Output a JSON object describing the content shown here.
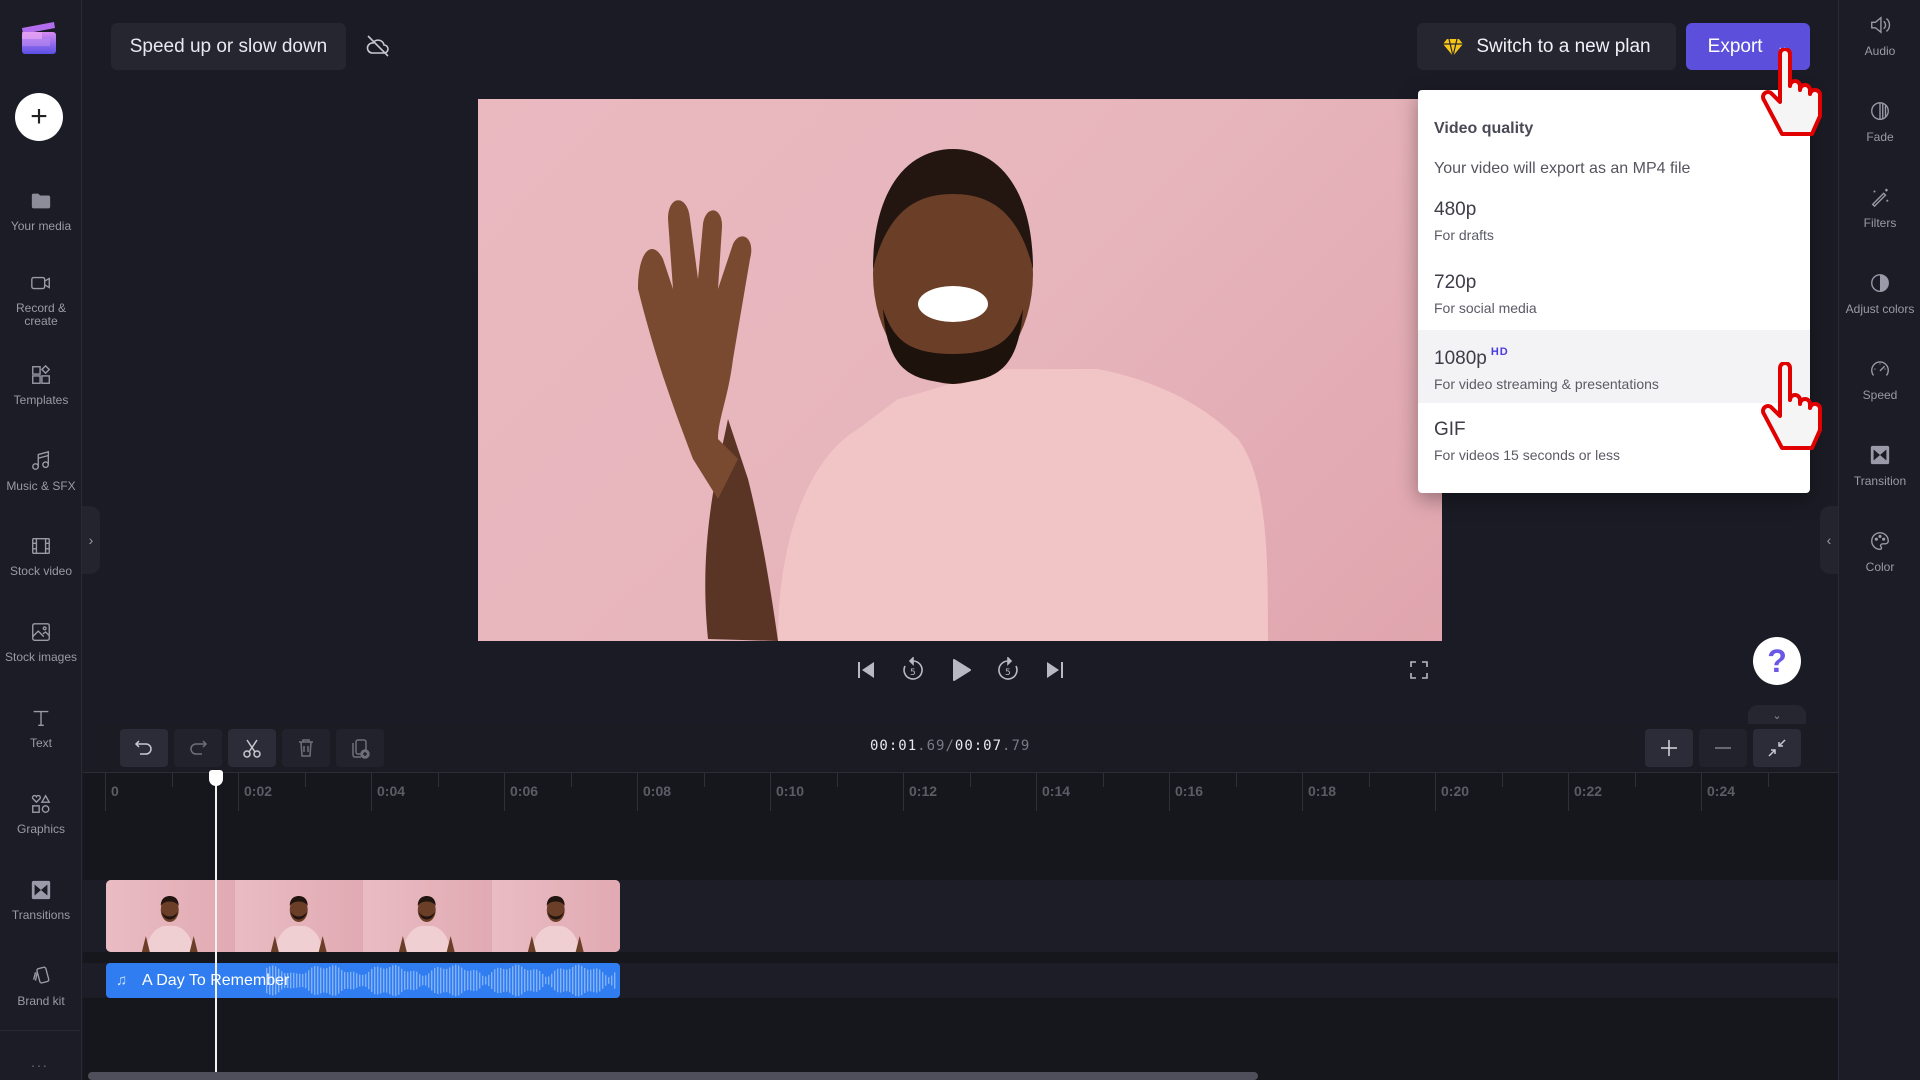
{
  "app": {
    "project_title": "Speed up or slow down",
    "cloud_status_icon": "cloud-off-icon"
  },
  "header": {
    "plan_button": "Switch to a new plan",
    "plan_icon": "diamond-icon",
    "export_button": "Export",
    "export_color": "#5b4fdb"
  },
  "left_sidebar": {
    "add_icon": "plus-icon",
    "items": [
      {
        "label": "Your media",
        "icon": "folder-icon"
      },
      {
        "label": "Record & create",
        "icon": "camera-icon"
      },
      {
        "label": "Templates",
        "icon": "templates-icon"
      },
      {
        "label": "Music & SFX",
        "icon": "music-icon"
      },
      {
        "label": "Stock video",
        "icon": "film-icon"
      },
      {
        "label": "Stock images",
        "icon": "image-icon"
      },
      {
        "label": "Text",
        "icon": "text-icon"
      },
      {
        "label": "Graphics",
        "icon": "shapes-icon"
      },
      {
        "label": "Transitions",
        "icon": "transition-icon"
      },
      {
        "label": "Brand kit",
        "icon": "brand-kit-icon"
      }
    ],
    "more_label": "..."
  },
  "right_sidebar": {
    "items": [
      {
        "label": "Audio",
        "icon": "speaker-icon"
      },
      {
        "label": "Fade",
        "icon": "fade-icon"
      },
      {
        "label": "Filters",
        "icon": "magic-wand-icon"
      },
      {
        "label": "Adjust colors",
        "icon": "contrast-icon"
      },
      {
        "label": "Speed",
        "icon": "speedometer-icon"
      },
      {
        "label": "Transition",
        "icon": "transition-icon"
      },
      {
        "label": "Color",
        "icon": "palette-icon"
      }
    ]
  },
  "export_menu": {
    "title": "Video quality",
    "subtitle": "Your video will export as an MP4 file",
    "options": [
      {
        "name": "480p",
        "desc": "For drafts",
        "badge": ""
      },
      {
        "name": "720p",
        "desc": "For social media",
        "badge": ""
      },
      {
        "name": "1080p",
        "desc": "For video streaming & presentations",
        "badge": "HD",
        "highlighted": true
      },
      {
        "name": "GIF",
        "desc": "For videos 15 seconds or less",
        "badge": ""
      }
    ]
  },
  "player": {
    "controls": [
      "skip-to-start",
      "rewind-5",
      "play",
      "forward-5",
      "skip-to-end",
      "fullscreen"
    ],
    "help_label": "?"
  },
  "timeline": {
    "current_time_main": "00:01",
    "current_time_frac": ".69",
    "separator": "/",
    "total_time_main": "00:07",
    "total_time_frac": ".79",
    "toolbar": [
      "undo",
      "redo",
      "split",
      "delete",
      "duplicate"
    ],
    "zoom_controls": [
      "zoom-in",
      "zoom-out",
      "fit"
    ],
    "ruler_labels": [
      "0",
      "0:02",
      "0:04",
      "0:06",
      "0:08",
      "0:10",
      "0:12",
      "0:14",
      "0:16",
      "0:18",
      "0:20",
      "0:22",
      "0:24"
    ],
    "audio_track_name": "A Day To Remember",
    "video_thumbnail_count": 4
  }
}
